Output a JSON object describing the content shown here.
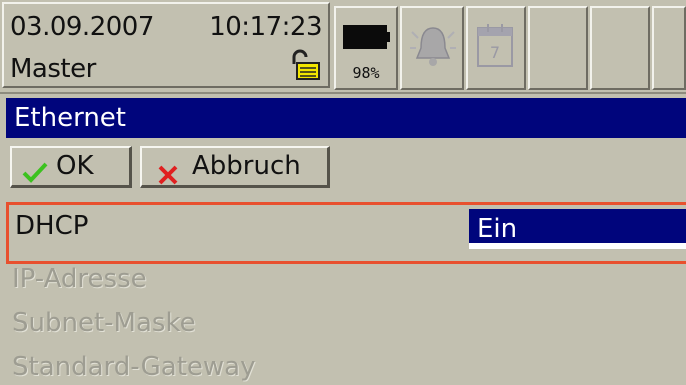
{
  "status": {
    "date": "03.09.2007",
    "time": "10:17:23",
    "user": "Master",
    "battery_percent": "98%",
    "icons": [
      "lock-open-icon",
      "battery-icon",
      "alarm-bell-icon",
      "calendar-icon"
    ]
  },
  "dialog": {
    "title": "Ethernet",
    "ok_label": "OK",
    "cancel_label": "Abbruch"
  },
  "fields": {
    "dhcp_label": "DHCP",
    "dhcp_value": "Ein",
    "ip_label": "IP-Adresse",
    "subnet_label": "Subnet-Maske",
    "gateway_label": "Standard-Gateway"
  },
  "colors": {
    "title_bar": "#00057c",
    "focus_border": "#e8502e",
    "panel": "#c2c0b0"
  }
}
